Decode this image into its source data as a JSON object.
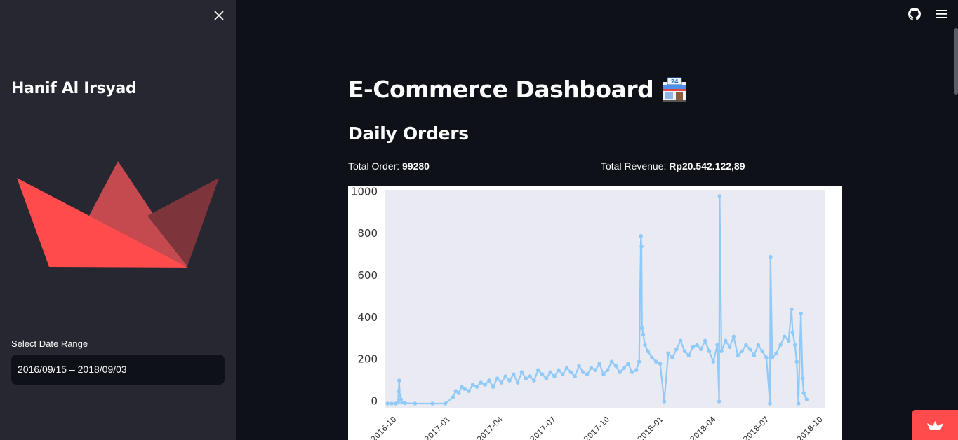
{
  "sidebar": {
    "author": "Hanif Al Irsyad",
    "date_label": "Select Date Range",
    "date_value": "2016/09/15 – 2018/09/03"
  },
  "main": {
    "title": "E-Commerce Dashboard",
    "title_icon": "convenience-store-emoji",
    "section": "Daily Orders",
    "total_order_label": "Total Order: ",
    "total_order_value": "99280",
    "total_revenue_label": "Total Revenue: ",
    "total_revenue_value": "Rp20.542.122,89"
  },
  "icons": {
    "close": "close-icon",
    "github": "github-icon",
    "menu": "hamburger-menu-icon",
    "badge": "streamlit-crown-icon"
  },
  "colors": {
    "background": "#0e1117",
    "sidebar": "#262730",
    "accent": "#ff4b4b",
    "line": "#90caf9",
    "plot_bg": "#eaeaf2"
  },
  "chart_data": {
    "type": "line",
    "title": "",
    "xlabel": "",
    "ylabel": "",
    "ylim": [
      -40,
      1000
    ],
    "yticks": [
      0,
      200,
      400,
      600,
      800,
      1000
    ],
    "xticks": [
      "2016-10",
      "2017-01",
      "2017-04",
      "2017-07",
      "2017-10",
      "2018-01",
      "2018-04",
      "2018-07",
      "2018-10"
    ],
    "xlim": [
      "2016-09-10",
      "2018-10-05"
    ],
    "grid": false,
    "markers": true,
    "series": [
      {
        "x": [
          "2016-09-15",
          "2016-09-22",
          "2016-09-29",
          "2016-10-03",
          "2016-10-04",
          "2016-10-05",
          "2016-10-06",
          "2016-10-08",
          "2016-10-10",
          "2016-10-15",
          "2016-11-01",
          "2016-12-01",
          "2016-12-23",
          "2017-01-05",
          "2017-01-10",
          "2017-01-15",
          "2017-01-20",
          "2017-01-25",
          "2017-02-01",
          "2017-02-08",
          "2017-02-15",
          "2017-02-22",
          "2017-03-01",
          "2017-03-08",
          "2017-03-15",
          "2017-03-22",
          "2017-03-29",
          "2017-04-05",
          "2017-04-12",
          "2017-04-19",
          "2017-04-26",
          "2017-05-03",
          "2017-05-10",
          "2017-05-17",
          "2017-05-24",
          "2017-05-31",
          "2017-06-07",
          "2017-06-14",
          "2017-06-21",
          "2017-06-28",
          "2017-07-05",
          "2017-07-12",
          "2017-07-19",
          "2017-07-26",
          "2017-08-02",
          "2017-08-09",
          "2017-08-16",
          "2017-08-23",
          "2017-08-30",
          "2017-09-06",
          "2017-09-13",
          "2017-09-20",
          "2017-09-27",
          "2017-10-04",
          "2017-10-11",
          "2017-10-18",
          "2017-10-25",
          "2017-11-01",
          "2017-11-08",
          "2017-11-15",
          "2017-11-20",
          "2017-11-23",
          "2017-11-24",
          "2017-11-25",
          "2017-11-27",
          "2017-11-30",
          "2017-12-05",
          "2017-12-12",
          "2017-12-19",
          "2017-12-26",
          "2018-01-02",
          "2018-01-09",
          "2018-01-16",
          "2018-01-23",
          "2018-01-30",
          "2018-02-06",
          "2018-02-13",
          "2018-02-20",
          "2018-02-27",
          "2018-03-06",
          "2018-03-13",
          "2018-03-20",
          "2018-03-27",
          "2018-04-03",
          "2018-04-06",
          "2018-04-07",
          "2018-04-10",
          "2018-04-17",
          "2018-04-24",
          "2018-05-01",
          "2018-05-08",
          "2018-05-15",
          "2018-05-22",
          "2018-05-29",
          "2018-06-05",
          "2018-06-12",
          "2018-06-19",
          "2018-06-26",
          "2018-07-02",
          "2018-07-03",
          "2018-07-06",
          "2018-07-13",
          "2018-07-20",
          "2018-07-27",
          "2018-08-03",
          "2018-08-08",
          "2018-08-10",
          "2018-08-14",
          "2018-08-17",
          "2018-08-20",
          "2018-08-24",
          "2018-08-27",
          "2018-08-29",
          "2018-09-03"
        ],
        "values": [
          0,
          0,
          0,
          5,
          60,
          110,
          40,
          20,
          5,
          2,
          0,
          0,
          0,
          30,
          60,
          50,
          80,
          70,
          60,
          90,
          80,
          100,
          90,
          110,
          80,
          120,
          100,
          130,
          110,
          140,
          100,
          150,
          120,
          130,
          110,
          160,
          140,
          120,
          150,
          130,
          160,
          140,
          170,
          150,
          130,
          180,
          150,
          140,
          170,
          160,
          190,
          140,
          160,
          200,
          180,
          150,
          170,
          190,
          150,
          160,
          200,
          800,
          750,
          360,
          330,
          280,
          250,
          220,
          200,
          190,
          10,
          240,
          220,
          260,
          300,
          250,
          230,
          270,
          280,
          260,
          300,
          250,
          200,
          280,
          10,
          990,
          250,
          300,
          270,
          320,
          230,
          250,
          280,
          260,
          230,
          280,
          250,
          220,
          0,
          700,
          220,
          240,
          280,
          320,
          300,
          450,
          340,
          280,
          200,
          0,
          430,
          120,
          50,
          20
        ]
      }
    ]
  }
}
